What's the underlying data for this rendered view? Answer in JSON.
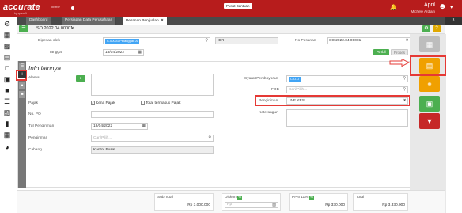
{
  "topbar": {
    "logo": "accurate",
    "logo_sub": "by cpssoft",
    "online": "online",
    "company": "Pusat Bantuan",
    "user_name": "April",
    "user_sub": "Michele Ardiani",
    "colors": {
      "brand": "#b71c1c"
    }
  },
  "tabs": [
    {
      "label": "Dashboard"
    },
    {
      "label": "Persiapan Data Perusahaan"
    },
    {
      "label": "Pesanan Penjualan"
    }
  ],
  "tab_close": "×",
  "tab_count": "3",
  "toolbar": {
    "doc_number": "SO.2022.04.00001",
    "close": "×"
  },
  "header": {
    "dipesan_oleh_label": "Dipesan oleh",
    "dipesan_oleh_value": "C.00001 Pelanggan A",
    "search_placeholder": "",
    "idr": "IDR",
    "no_pesanan_label": "No Pesanan",
    "no_pesanan_value": "SO.2022.04.00001",
    "tanggal_label": "Tanggal",
    "tanggal_value": "18/04/2022",
    "ambil_btn": "Ambil",
    "proses_btn": "Proses"
  },
  "info": {
    "title": "Info lainnya",
    "alamat_label": "Alamat",
    "pajak_label": "Pajak",
    "kena_pajak": "Kena Pajak",
    "total_termasuk_pajak": "Total termasuk Pajak",
    "no_po_label": "No. PO",
    "tgl_pengiriman_label": "Tgl Pengiriman",
    "tgl_pengiriman_value": "18/04/2022",
    "pengiriman_left_label": "Pengiriman",
    "pengiriman_left_placeholder": "Cari/Pilih...",
    "cabang_label": "Cabang",
    "cabang_value": "Kantor Pusat",
    "syarat_label": "Syarat Pembayaran",
    "syarat_value": "C.O.D",
    "fob_label": "FOB",
    "fob_placeholder": "Cari/Pilih...",
    "pengiriman_right_label": "Pengiriman",
    "pengiriman_right_value": "JNE YES",
    "keterangan_label": "Keterangan"
  },
  "footer": {
    "subtotal_label": "Sub Total",
    "subtotal_value": "Rp 3.000.000",
    "diskon_label": "Diskon",
    "diskon_badge": "%",
    "diskon_placeholder": "Rp",
    "ppn_label": "PPN 11%",
    "ppn_badge": "%",
    "ppn_value": "Rp 330.000",
    "total_label": "Total",
    "total_value": "Rp 3.330.000"
  }
}
